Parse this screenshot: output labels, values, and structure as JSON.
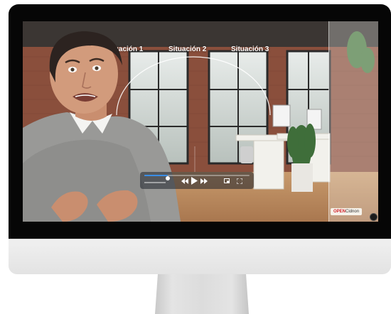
{
  "video": {
    "situations": [
      "Situación 1",
      "Situación 2",
      "Situación 3"
    ],
    "progress_fraction": 0.22,
    "logo_text_a": "OPEN",
    "logo_text_b": "Cidnon"
  },
  "controls": {
    "icons": [
      "volume-icon",
      "rewind-icon",
      "play-icon",
      "fast-forward-icon",
      "pip-icon",
      "fullscreen-icon"
    ]
  },
  "colors": {
    "bezel": "#060606",
    "chin": "#e9e9e9",
    "accent": "#3a8ee6",
    "brick": "#8a4f3c"
  }
}
